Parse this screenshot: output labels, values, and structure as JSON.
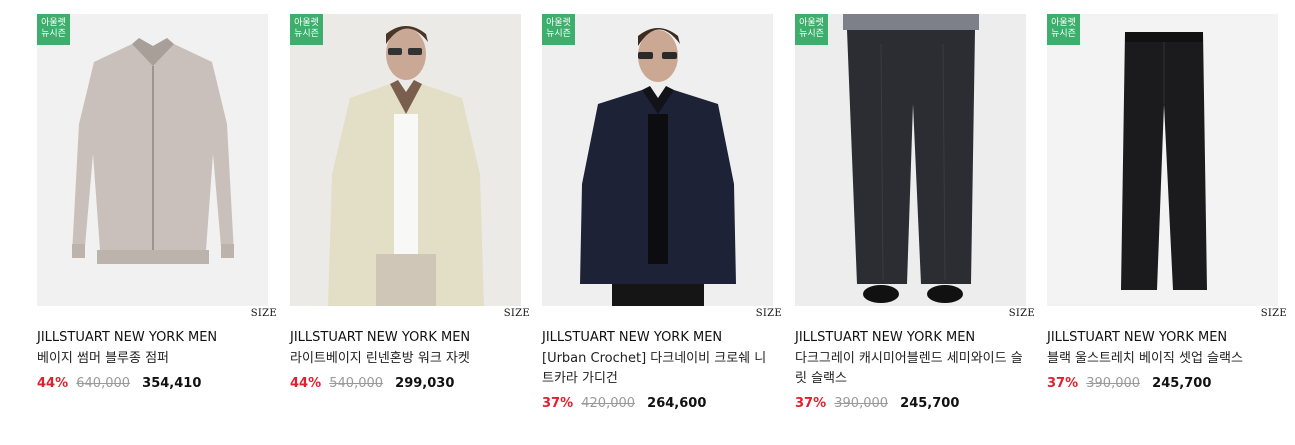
{
  "products": [
    {
      "badge": [
        "아울렛",
        "뉴시즌"
      ],
      "size_label": "SIZE",
      "brand": "JILLSTUART NEW YORK MEN",
      "name": "베이지 썸머 블루종 점퍼",
      "discount": "44%",
      "original_price": "640,000",
      "sale_price": "354,410",
      "image_desc": "beige-blouson-jacket",
      "colors": {
        "bg": "#f1f1f1",
        "garment": "#c9c0bb"
      }
    },
    {
      "badge": [
        "아울렛",
        "뉴시즌"
      ],
      "size_label": "SIZE",
      "brand": "JILLSTUART NEW YORK MEN",
      "name": "라이트베이지 린넨혼방 워크 자켓",
      "discount": "44%",
      "original_price": "540,000",
      "sale_price": "299,030",
      "image_desc": "model-linen-work-jacket",
      "colors": {
        "bg": "#eceae6",
        "garment": "#e3dfc6"
      }
    },
    {
      "badge": [
        "아울렛",
        "뉴시즌"
      ],
      "size_label": "SIZE",
      "brand": "JILLSTUART NEW YORK MEN",
      "name": "[Urban Crochet] 다크네이비 크로쉐 니트카라 가디건",
      "discount": "37%",
      "original_price": "420,000",
      "sale_price": "264,600",
      "image_desc": "model-navy-crochet-cardigan",
      "colors": {
        "bg": "#efefef",
        "garment": "#1e2236"
      }
    },
    {
      "badge": [
        "아울렛",
        "뉴시즌"
      ],
      "size_label": "SIZE",
      "brand": "JILLSTUART NEW YORK MEN",
      "name": "다크그레이 캐시미어블렌드 세미와이드 슬릿 슬랙스",
      "discount": "37%",
      "original_price": "390,000",
      "sale_price": "245,700",
      "image_desc": "model-dark-grey-slacks",
      "colors": {
        "bg": "#ededed",
        "garment": "#2b2d33"
      }
    },
    {
      "badge": [
        "아울렛",
        "뉴시즌"
      ],
      "size_label": "SIZE",
      "brand": "JILLSTUART NEW YORK MEN",
      "name": "블랙 울스트레치 베이직 셋업 슬랙스",
      "discount": "37%",
      "original_price": "390,000",
      "sale_price": "245,700",
      "image_desc": "black-wool-slacks",
      "colors": {
        "bg": "#f3f3f3",
        "garment": "#1b1b1d"
      }
    }
  ]
}
